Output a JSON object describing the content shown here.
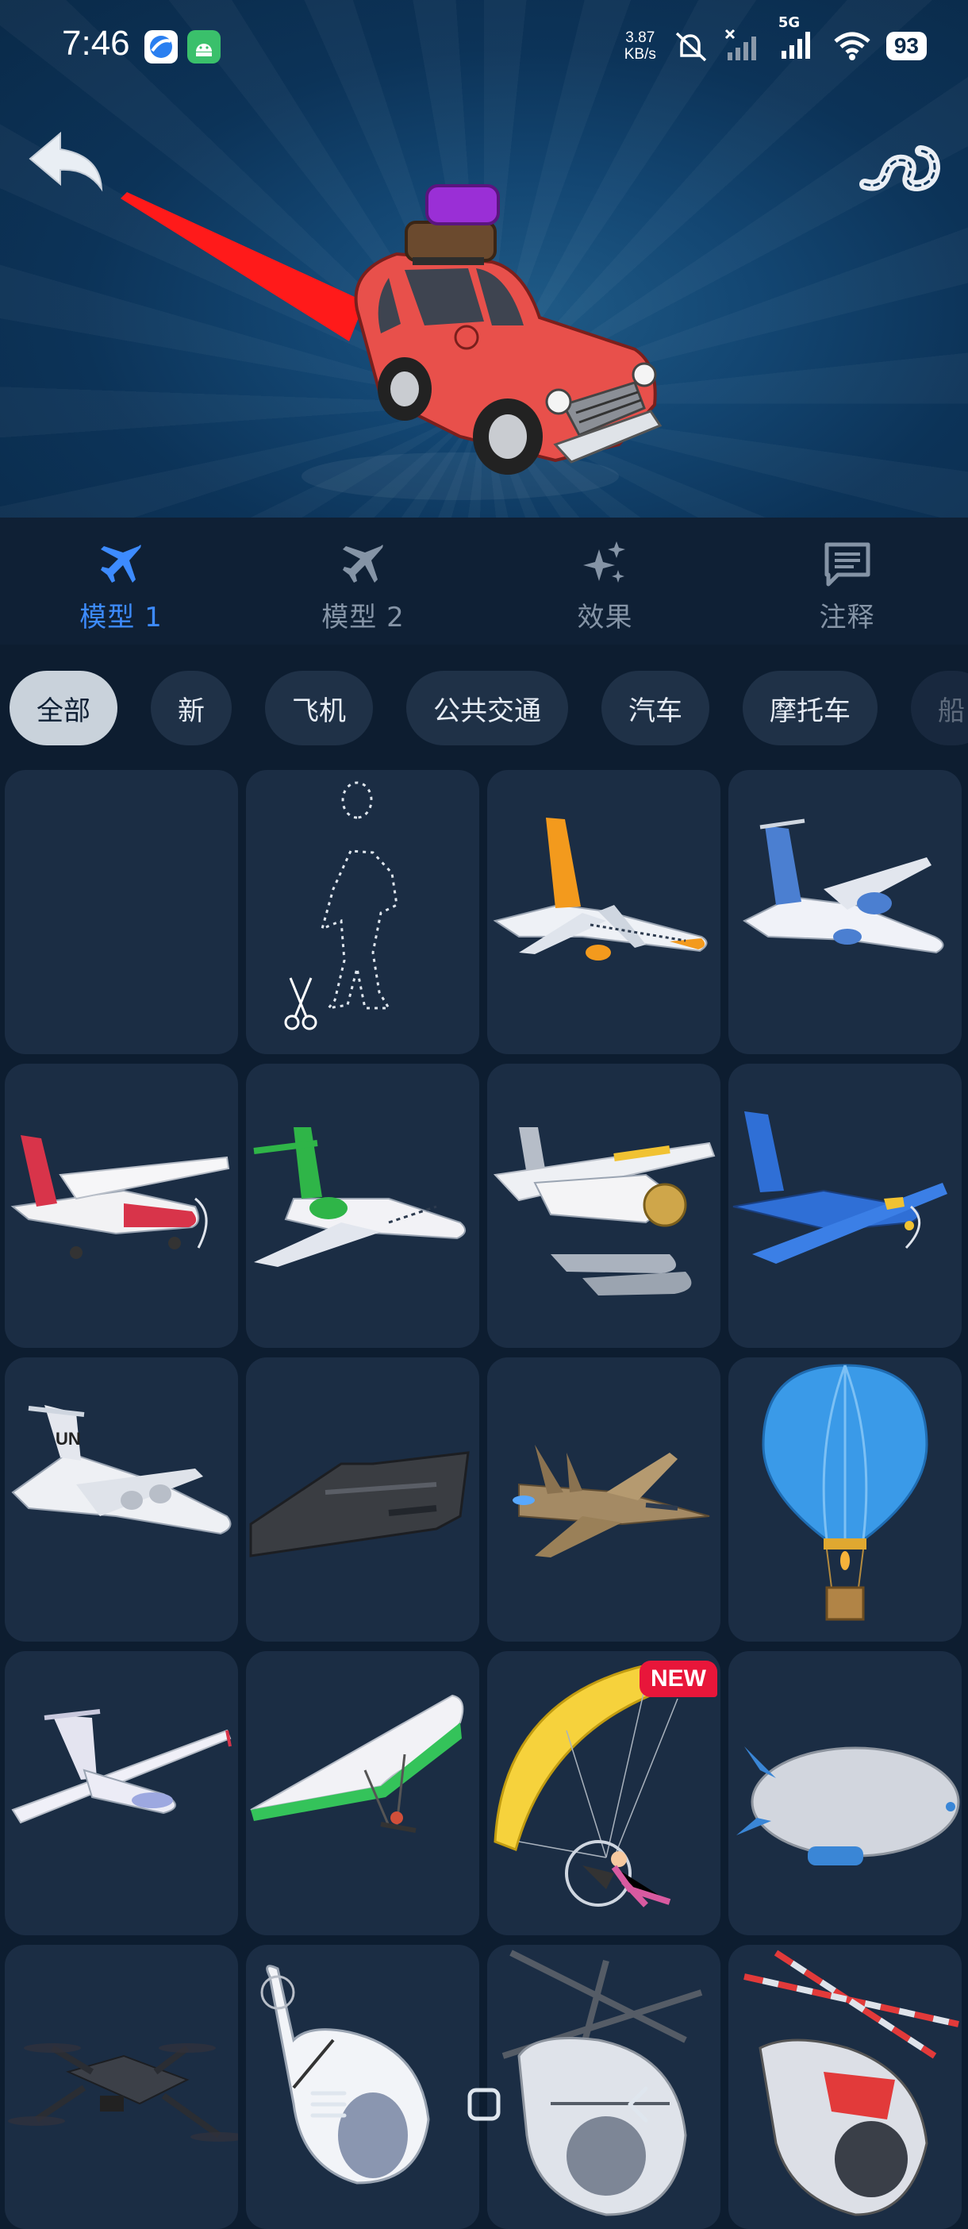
{
  "status_bar": {
    "time": "7:46",
    "net_speed_value": "3.87",
    "net_speed_unit": "KB/s",
    "network_type": "5G",
    "battery": "93",
    "icons": [
      "browser-app-icon",
      "android-app-icon",
      "mute-icon",
      "no-signal-icon",
      "signal-icon",
      "wifi-icon"
    ]
  },
  "preview": {
    "route_color": "#ff1a1a",
    "icons": [
      "back-arrow-icon",
      "route-style-icon"
    ]
  },
  "tabs": [
    {
      "label": "模型 1",
      "icon": "airplane-icon",
      "active": true
    },
    {
      "label": "模型 2",
      "icon": "airplane-icon",
      "active": false
    },
    {
      "label": "效果",
      "icon": "sparkle-icon",
      "active": false
    },
    {
      "label": "注释",
      "icon": "comment-icon",
      "active": false
    }
  ],
  "accent_color": "#3d8bff",
  "chips": [
    "全部",
    "新",
    "飞机",
    "公共交通",
    "汽车",
    "摩托车",
    "船"
  ],
  "selected_chip": "全部",
  "models": [
    {
      "id": "empty",
      "badge": ""
    },
    {
      "id": "custom-cutout",
      "badge": ""
    },
    {
      "id": "jet-orange",
      "badge": ""
    },
    {
      "id": "turboprop-blue",
      "badge": ""
    },
    {
      "id": "cessna-red",
      "badge": ""
    },
    {
      "id": "business-jet-green",
      "badge": ""
    },
    {
      "id": "seaplane",
      "badge": ""
    },
    {
      "id": "small-plane-blue",
      "badge": ""
    },
    {
      "id": "cargo-un",
      "badge": ""
    },
    {
      "id": "stealth-bomber",
      "badge": ""
    },
    {
      "id": "fighter-jet",
      "badge": ""
    },
    {
      "id": "hot-air-balloon",
      "badge": ""
    },
    {
      "id": "glider",
      "badge": ""
    },
    {
      "id": "hang-glider",
      "badge": ""
    },
    {
      "id": "paramotor",
      "badge": "NEW"
    },
    {
      "id": "blimp",
      "badge": ""
    },
    {
      "id": "drone",
      "badge": ""
    },
    {
      "id": "helicopter-white",
      "badge": ""
    },
    {
      "id": "helicopter-grey",
      "badge": ""
    },
    {
      "id": "helicopter-red",
      "badge": ""
    }
  ],
  "nav_bar": [
    "menu-icon",
    "home-icon",
    "back-icon"
  ]
}
